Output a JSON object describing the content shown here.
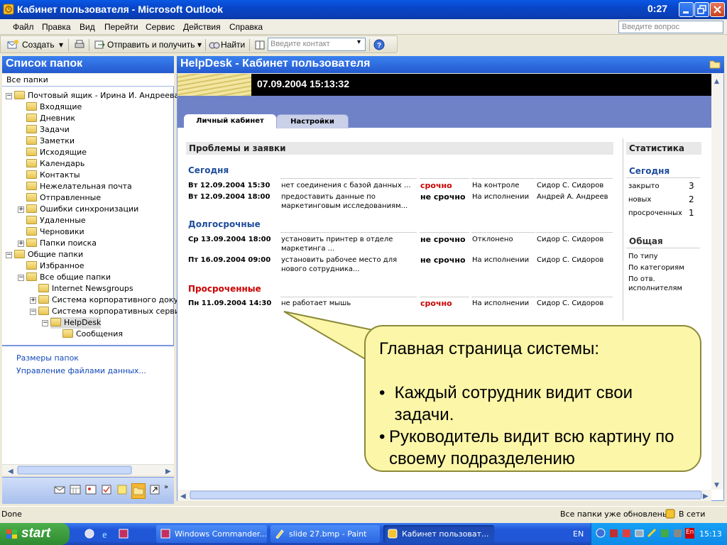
{
  "window": {
    "title": "Кабинет пользователя - Microsoft Outlook",
    "clock": "0:27"
  },
  "menu": {
    "items": [
      "Файл",
      "Правка",
      "Вид",
      "Перейти",
      "Сервис",
      "Действия",
      "Справка"
    ],
    "ask_placeholder": "Введите вопрос"
  },
  "toolbar": {
    "create": "Создать",
    "send_receive": "Отправить и получить",
    "find": "Найти",
    "contact_placeholder": "Введите контакт"
  },
  "left": {
    "title": "Список папок",
    "all_folders": "Все папки",
    "tree": [
      {
        "label": "Почтовый ящик - Ирина И. Андреева"
      },
      {
        "label": "Входящие"
      },
      {
        "label": "Дневник"
      },
      {
        "label": "Задачи"
      },
      {
        "label": "Заметки"
      },
      {
        "label": "Исходящие"
      },
      {
        "label": "Календарь"
      },
      {
        "label": "Контакты"
      },
      {
        "label": "Нежелательная почта"
      },
      {
        "label": "Отправленные"
      },
      {
        "label": "Ошибки синхронизации"
      },
      {
        "label": "Удаленные"
      },
      {
        "label": "Черновики"
      },
      {
        "label": "Папки поиска"
      },
      {
        "label": "Общие папки"
      },
      {
        "label": "Избранное"
      },
      {
        "label": "Все общие папки"
      },
      {
        "label": "Internet Newsgroups"
      },
      {
        "label": "Система корпоративного документооборота"
      },
      {
        "label": "Система корпоративных сервисов"
      },
      {
        "label": "HelpDesk"
      },
      {
        "label": "Сообщения"
      }
    ],
    "links": [
      "Размеры папок",
      "Управление файлами данных..."
    ]
  },
  "right": {
    "title": "HelpDesk - Кабинет пользователя",
    "datetime": "07.09.2004 15:13:32",
    "tabs": [
      "Личный кабинет",
      "Настройки"
    ],
    "section_title": "Проблемы и заявки",
    "groups": {
      "today": "Сегодня",
      "long": "Долгосрочные",
      "overdue": "Просроченные"
    },
    "rows": [
      {
        "date": "Вт 12.09.2004 15:30",
        "desc": "нет соединения с базой данных ...",
        "urgency": "срочно",
        "status": "На контроле",
        "person": "Сидор С. Сидоров"
      },
      {
        "date": "Вт 12.09.2004 18:00",
        "desc": "предоставить данные по маркетинговым исследованиям...",
        "urgency": "не срочно",
        "status": "На исполнении",
        "person": "Андрей А. Андреев"
      },
      {
        "date": "Ср 13.09.2004 18:00",
        "desc": "установить принтер в отделе маркетинга ...",
        "urgency": "не срочно",
        "status": "Отклонено",
        "person": "Сидор С. Сидоров"
      },
      {
        "date": "Пт 16.09.2004 09:00",
        "desc": "установить рабочее место для нового сотрудника...",
        "urgency": "не срочно",
        "status": "На исполнении",
        "person": "Сидор С. Сидоров"
      },
      {
        "date": "Пн 11.09.2004 14:30",
        "desc": "не работает мышь",
        "urgency": "срочно",
        "status": "На исполнении",
        "person": "Сидор С. Сидоров"
      }
    ],
    "stats": {
      "title": "Статистика",
      "today": "Сегодня",
      "items": [
        {
          "label": "закрыто",
          "value": "3"
        },
        {
          "label": "новых",
          "value": "2"
        },
        {
          "label": "просроченных",
          "value": "1"
        }
      ],
      "general": "Общая",
      "links": [
        "По типу",
        "По категориям",
        "По отв. исполнителям"
      ]
    }
  },
  "callout": {
    "heading": "Главная страница системы:",
    "bullets": [
      "Каждый сотрудник видит свои задачи.",
      "Руководитель видит всю картину по своему подразделению"
    ]
  },
  "status": {
    "left": "Done",
    "updated": "Все папки уже обновлены.",
    "network": "В сети"
  },
  "taskbar": {
    "start": "start",
    "tasks": [
      "Windows Commander...",
      "slide 27.bmp - Paint",
      "Кабинет пользоват..."
    ],
    "lang": "EN",
    "clock": "15:13"
  },
  "colors": {
    "urgent": "#cc0000",
    "group_blue": "#1e4d9a",
    "overdue_red": "#cc0000",
    "callout_fill": "#fcf6a8",
    "xp_blue": "#2459d0"
  },
  "icons": [
    "outlook-icon",
    "create-icon",
    "print-icon",
    "send-receive-icon",
    "find-icon",
    "address-book-icon",
    "help-icon",
    "folder-icon",
    "start-windows-icon"
  ]
}
